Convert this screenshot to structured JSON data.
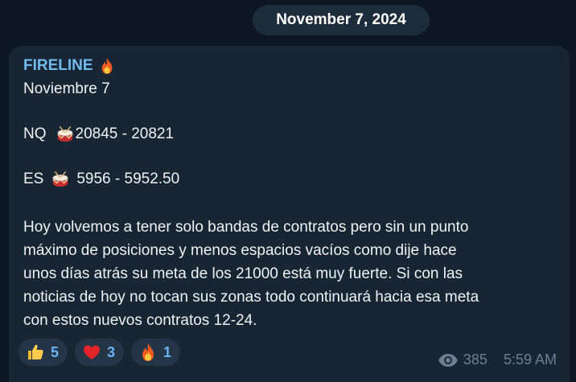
{
  "date_pill": "November 7, 2024",
  "message": {
    "sender": "FIRELINE",
    "sender_icon": "fire-icon",
    "lines": {
      "date": "Noviembre 7",
      "nq_label": "NQ",
      "nq_range": "20845 - 20821",
      "es_label": "ES",
      "es_range": "5956 - 5952.50",
      "body": [
        "Hoy volvemos a tener solo bandas de contratos pero sin un punto",
        "máximo de posiciones y menos espacios vacíos como dije hace",
        "unos días atrás su meta de los 21000 está muy fuerte. Si con las",
        "noticias de hoy no tocan sus zonas todo continuará hacia esa meta",
        "con estos nuevos contratos 12-24."
      ]
    },
    "reactions": [
      {
        "icon": "thumbs-up-icon",
        "count": "5"
      },
      {
        "icon": "heart-icon",
        "count": "3"
      },
      {
        "icon": "fire-icon",
        "count": "1"
      }
    ],
    "views": "385",
    "time": "5:59 AM"
  },
  "colors": {
    "background": "#0e1621",
    "bubble": "#182533",
    "sender": "#71baf0",
    "reaction_count": "#6ab3f3",
    "meta": "#6d7f8f"
  }
}
